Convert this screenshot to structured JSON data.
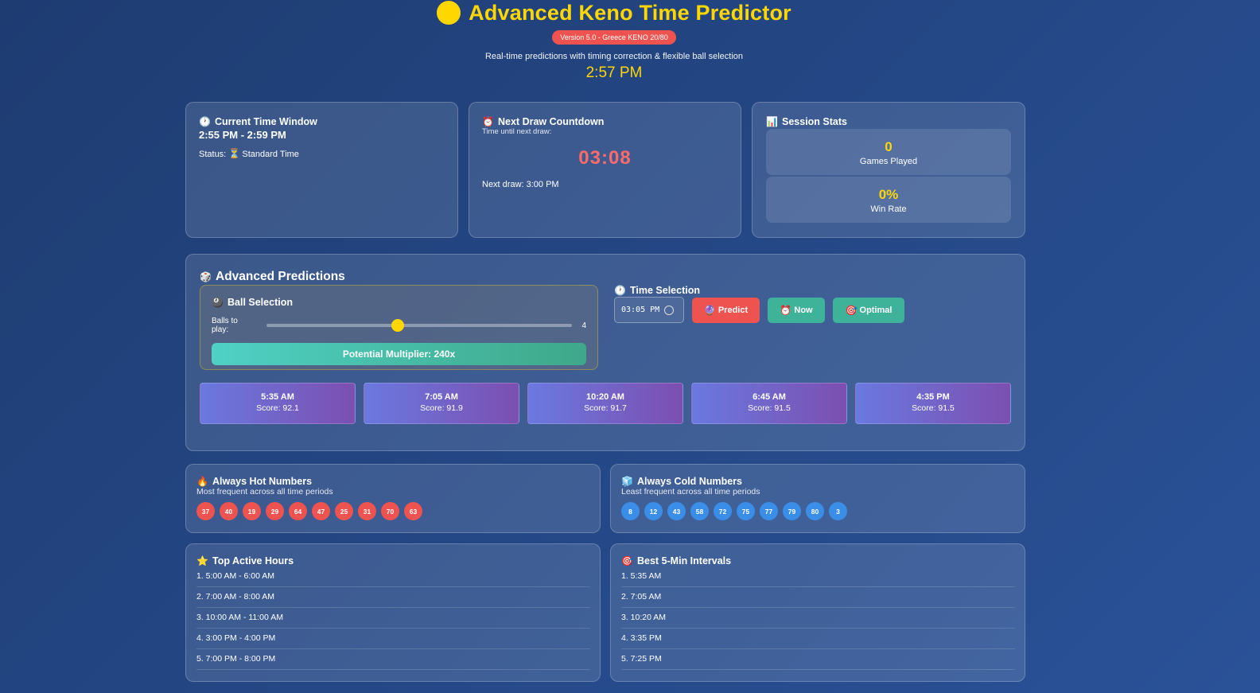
{
  "header": {
    "title": "Advanced Keno Time Predictor",
    "version": "Version 5.0 - Greece KENO 20/80",
    "subtitle": "Real-time predictions with timing correction & flexible ball selection",
    "clock": "2:57 PM",
    "logo_color": "#ffd700"
  },
  "time_window": {
    "title": "Current Time Window",
    "icon": "clock-icon",
    "range": "2:55 PM - 2:59 PM",
    "status_label": "Status:",
    "status_value": "Standard Time",
    "status_icon": "hourglass-icon"
  },
  "countdown": {
    "title": "Next Draw Countdown",
    "icon": "alarm-clock-icon",
    "caption": "Time until next draw:",
    "value": "03:08",
    "next_draw": "Next draw: 3:00 PM"
  },
  "session_stats": {
    "title": "Session Stats",
    "icon": "bar-chart-icon",
    "games_played_value": "0",
    "games_played_label": "Games Played",
    "win_rate_value": "0%",
    "win_rate_label": "Win Rate"
  },
  "predictions": {
    "title": "Advanced Predictions",
    "icon": "dice-icon",
    "ball_selection": {
      "title": "Ball Selection",
      "icon": "eight-ball-icon",
      "label": "Balls to play:",
      "value": "4",
      "slider_fraction": 0.43,
      "multiplier": "Potential Multiplier: 240x"
    },
    "time_selection": {
      "title": "Time Selection",
      "icon": "clock-icon",
      "input_value": "03:05 PM",
      "predict_label": "Predict",
      "now_label": "Now",
      "optimal_label": "Optimal"
    },
    "times": [
      {
        "time": "5:35 AM",
        "score": "Score: 92.1"
      },
      {
        "time": "7:05 AM",
        "score": "Score: 91.9"
      },
      {
        "time": "10:20 AM",
        "score": "Score: 91.7"
      },
      {
        "time": "6:45 AM",
        "score": "Score: 91.5"
      },
      {
        "time": "4:35 PM",
        "score": "Score: 91.5"
      }
    ]
  },
  "hot": {
    "title": "Always Hot Numbers",
    "icon": "fire-icon",
    "caption": "Most frequent across all time periods",
    "numbers": [
      "37",
      "40",
      "19",
      "29",
      "64",
      "47",
      "25",
      "31",
      "70",
      "63"
    ],
    "color": "#ef5350"
  },
  "cold": {
    "title": "Always Cold Numbers",
    "icon": "ice-cube-icon",
    "caption": "Least frequent across all time periods",
    "numbers": [
      "8",
      "12",
      "43",
      "58",
      "72",
      "75",
      "77",
      "79",
      "80",
      "3"
    ],
    "color": "#3b8ee8"
  },
  "top_hours": {
    "title": "Top Active Hours",
    "icon": "star-icon",
    "items": [
      "1. 5:00 AM - 6:00 AM",
      "2. 7:00 AM - 8:00 AM",
      "3. 10:00 AM - 11:00 AM",
      "4. 3:00 PM - 4:00 PM",
      "5. 7:00 PM - 8:00 PM"
    ]
  },
  "best_intervals": {
    "title": "Best 5-Min Intervals",
    "icon": "target-icon",
    "items": [
      "1. 5:35 AM",
      "2. 7:05 AM",
      "3. 10:20 AM",
      "4. 3:35 PM",
      "5. 7:25 PM"
    ]
  }
}
